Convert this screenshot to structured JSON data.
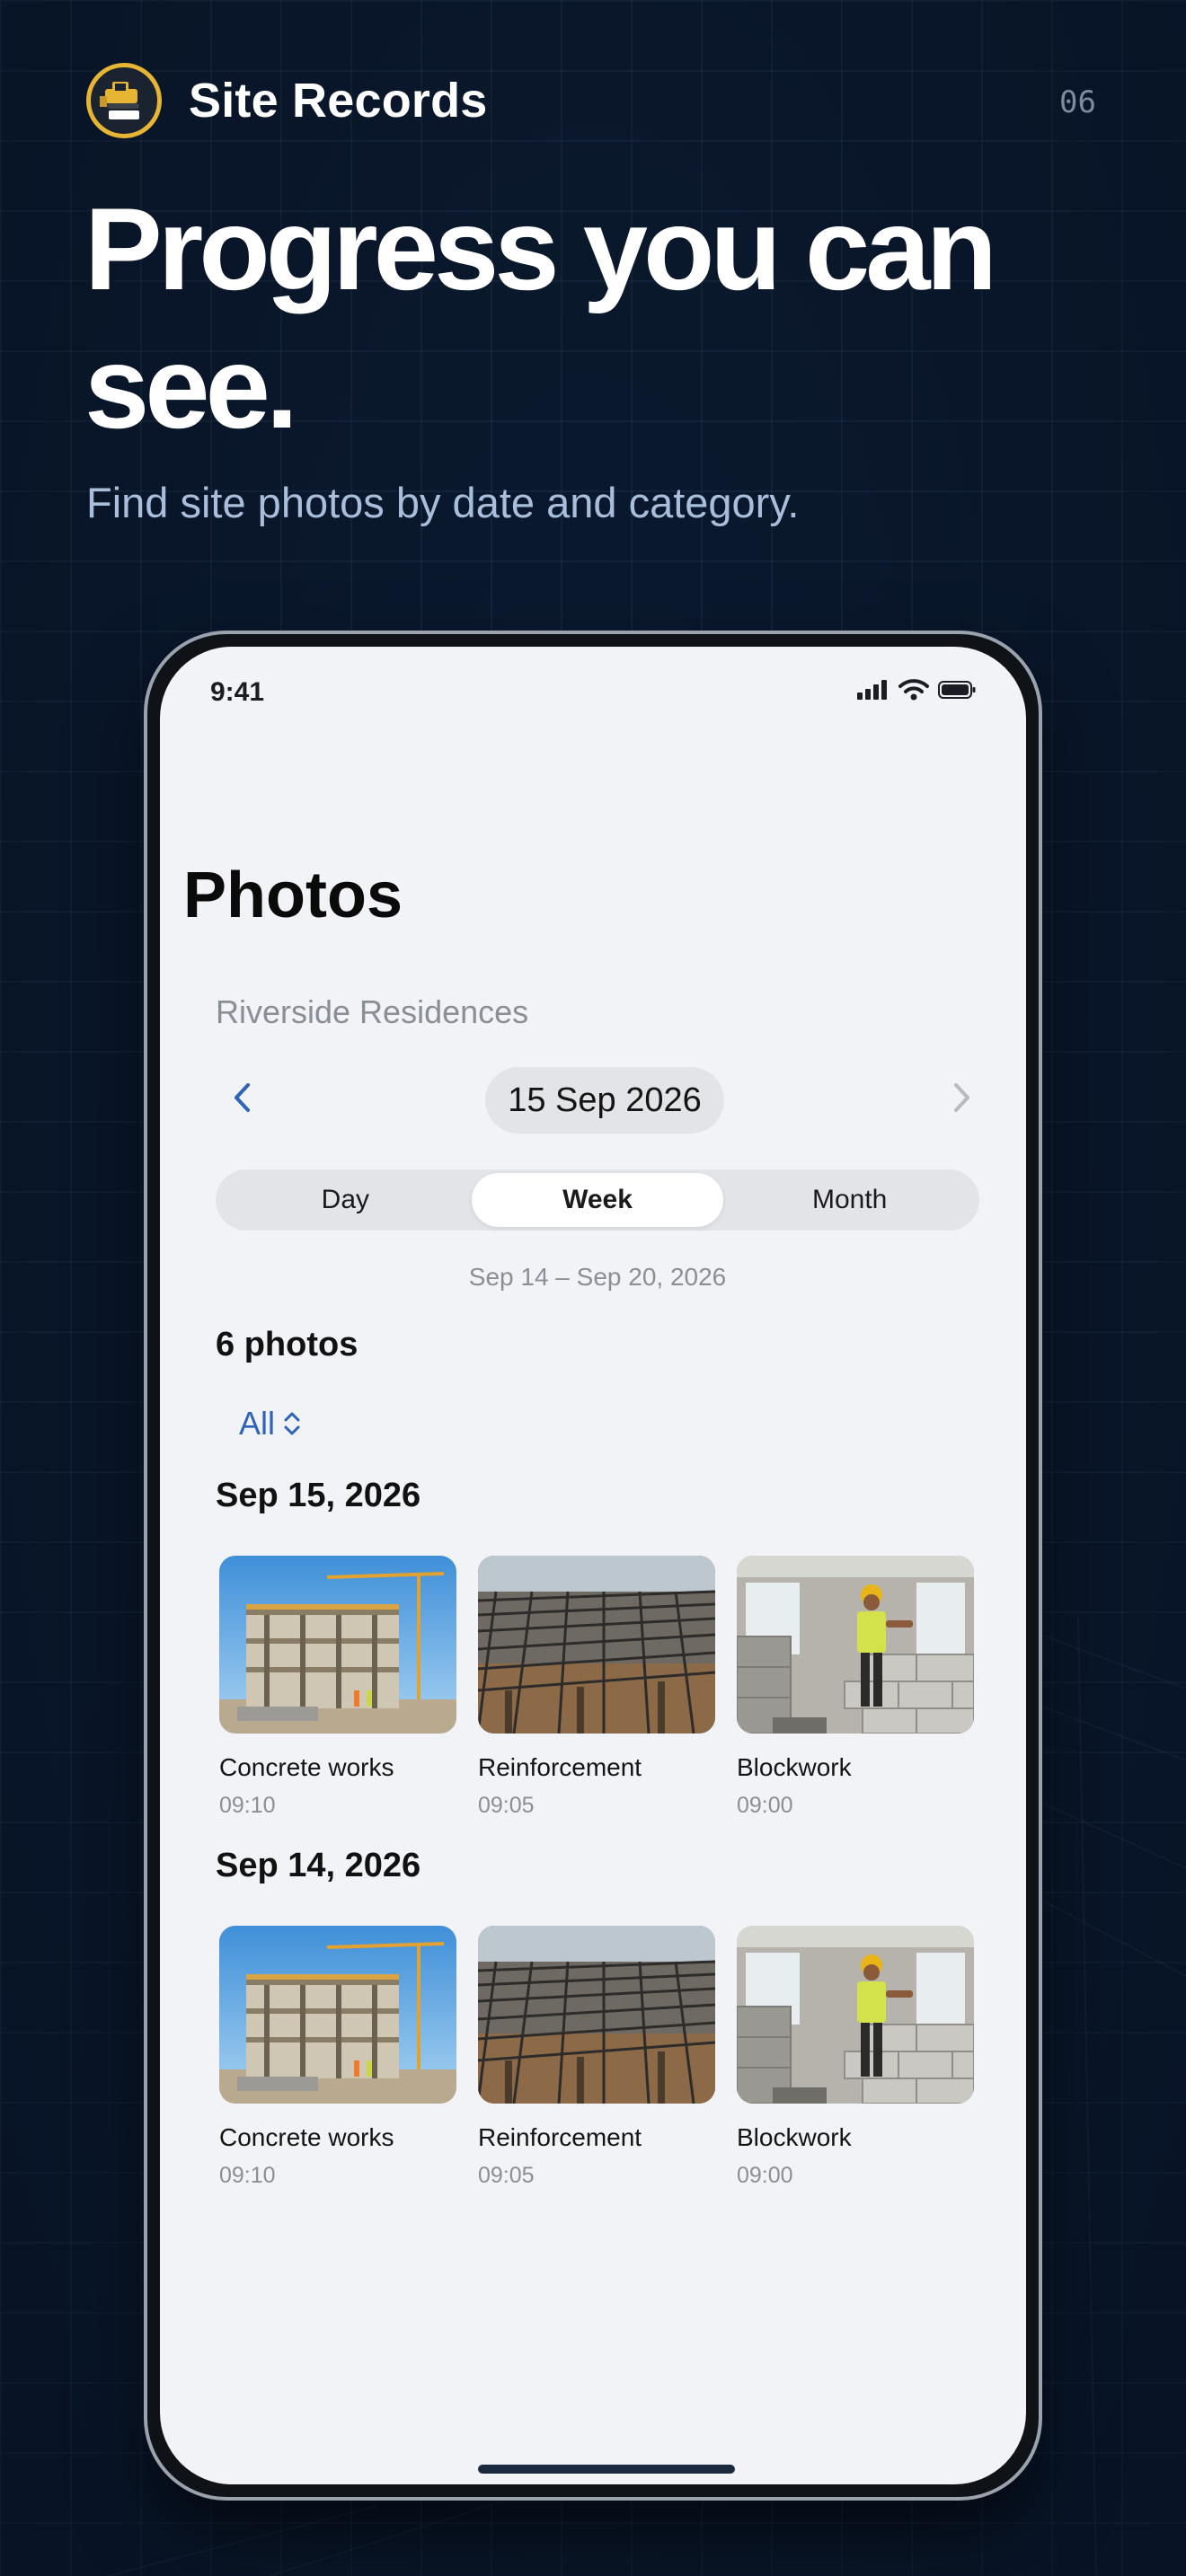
{
  "brand": {
    "name": "Site Records",
    "page_number": "06"
  },
  "hero": {
    "headline": "Progress you can see.",
    "subhead": "Find site photos by date and category."
  },
  "status_bar": {
    "time": "9:41"
  },
  "screen": {
    "title": "Photos",
    "project": "Riverside Residences",
    "date_picker": {
      "current": "15 Sep 2026"
    },
    "segments": [
      {
        "label": "Day",
        "selected": false
      },
      {
        "label": "Week",
        "selected": true
      },
      {
        "label": "Month",
        "selected": false
      }
    ],
    "range_label": "Sep 14 – Sep 20, 2026",
    "photo_count": "6 photos",
    "filter": {
      "value": "All"
    },
    "groups": [
      {
        "date": "Sep 15, 2026",
        "photos": [
          {
            "label": "Concrete works",
            "time": "09:10",
            "image": "building-frame"
          },
          {
            "label": "Reinforcement",
            "time": "09:05",
            "image": "rebar-grid"
          },
          {
            "label": "Blockwork",
            "time": "09:00",
            "image": "mason-worker"
          }
        ]
      },
      {
        "date": "Sep 14, 2026",
        "photos": [
          {
            "label": "Concrete works",
            "time": "09:10",
            "image": "building-frame"
          },
          {
            "label": "Reinforcement",
            "time": "09:05",
            "image": "rebar-grid"
          },
          {
            "label": "Blockwork",
            "time": "09:00",
            "image": "mason-worker"
          }
        ]
      }
    ]
  },
  "colors": {
    "background": "#0b1a30",
    "accent_blue": "#2d63b8",
    "logo_ring": "#e7b534",
    "screen_bg": "#f2f3f6"
  }
}
